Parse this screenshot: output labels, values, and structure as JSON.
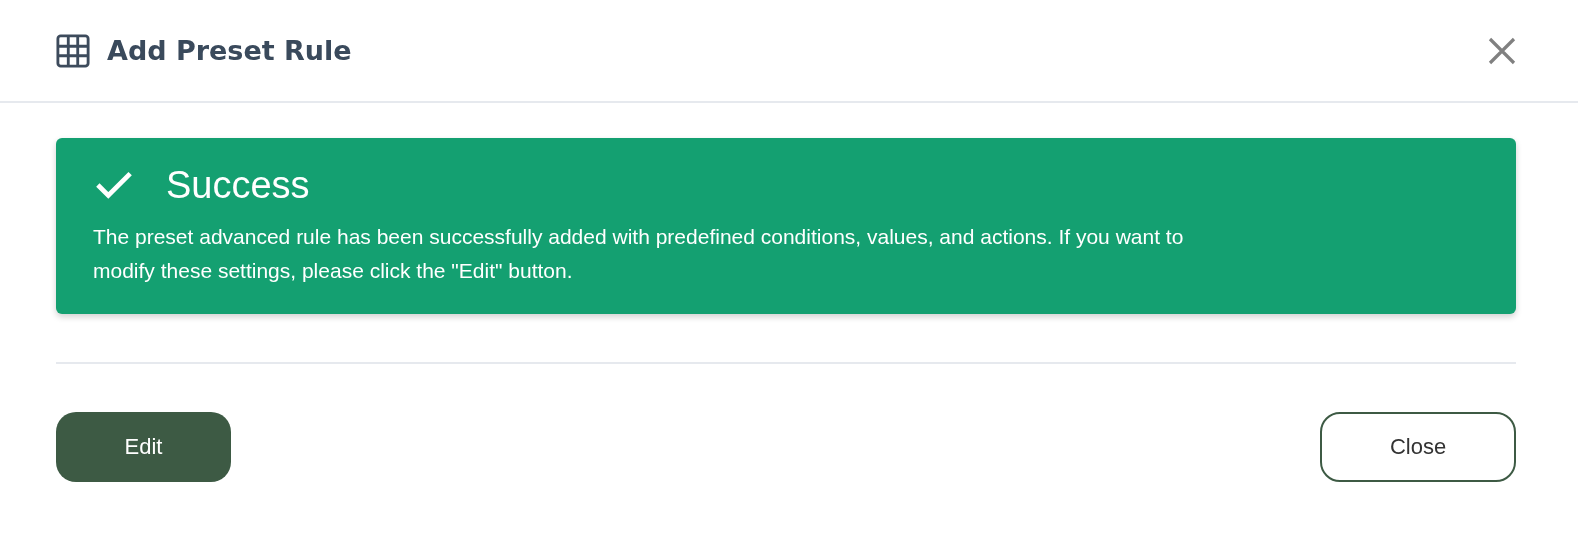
{
  "dialog": {
    "title": "Add Preset Rule"
  },
  "alert": {
    "kind": "success",
    "title": "Success",
    "message": "The preset advanced rule has been successfully added with predefined conditions, values, and actions. If you want to modify these settings, please click the \"Edit\" button."
  },
  "buttons": [
    {
      "label": "Edit",
      "kind": "primary"
    },
    {
      "label": "Close",
      "kind": "secondary"
    }
  ]
}
